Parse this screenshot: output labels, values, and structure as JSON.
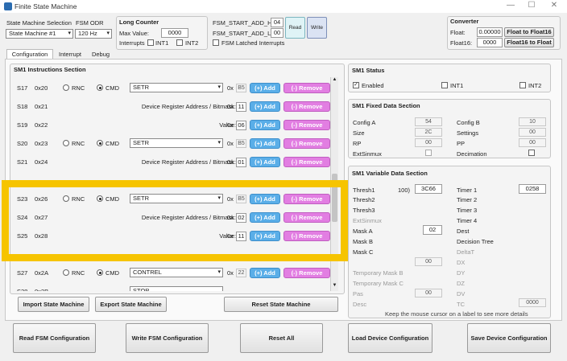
{
  "window": {
    "title": "Finite State Machine",
    "minimize": "—",
    "maximize": "☐",
    "close": "✕"
  },
  "top": {
    "sm_sel_label": "State Machine Selection",
    "sm_sel_value": "State Machine #1",
    "fsm_odr_label": "FSM ODR",
    "fsm_odr_value": "120 Hz",
    "long_counter_title": "Long Counter",
    "max_value_label": "Max Value:",
    "max_value": "0000",
    "interrupts_label": "Interrupts",
    "int1_label": "INT1",
    "int2_label": "INT2",
    "start_h_label": "FSM_START_ADD_H:",
    "start_h_value": "04",
    "start_l_label": "FSM_START_ADD_L:",
    "start_l_value": "00",
    "read_label": "Read",
    "write_label": "Write",
    "latched_label": "FSM Latched Interrupts",
    "converter_title": "Converter",
    "float_label": "Float:",
    "float_value": "0.00000",
    "to16_label": "Float to Float16",
    "float16_label": "Float16:",
    "float16_value": "0000",
    "from16_label": "Float16 to Float"
  },
  "tabs": [
    "Configuration",
    "Interrupt",
    "Debug"
  ],
  "instructions": {
    "title": "SM1 Instructions Section",
    "hex_prefix": "0x",
    "add_label": "(+) Add",
    "remove_label": "(-) Remove",
    "rnc_label": "RNC",
    "cmd_label": "CMD",
    "rows": [
      {
        "s": "S17",
        "a": "0x20",
        "type": "cmd",
        "sel": "SETR",
        "v": "B5"
      },
      {
        "s": "S18",
        "a": "0x21",
        "type": "param",
        "label": "Device Register Address / Bitmask:",
        "v": "11"
      },
      {
        "s": "S19",
        "a": "0x22",
        "type": "param",
        "label": "Value:",
        "v": "06"
      },
      {
        "s": "S20",
        "a": "0x23",
        "type": "cmd",
        "sel": "SETR",
        "v": "B5"
      },
      {
        "s": "S21",
        "a": "0x24",
        "type": "param",
        "label": "Device Register Address / Bitmask:",
        "v": "01"
      },
      {
        "s": "S23",
        "a": "0x26",
        "type": "cmd",
        "sel": "SETR",
        "v": "B5"
      },
      {
        "s": "S24",
        "a": "0x27",
        "type": "param",
        "label": "Device Register Address / Bitmask:",
        "v": "02"
      },
      {
        "s": "S25",
        "a": "0x28",
        "type": "param",
        "label": "Value:",
        "v": "11"
      },
      {
        "s": "S27",
        "a": "0x2A",
        "type": "cmd",
        "sel": "CONTREL",
        "v": "22"
      }
    ],
    "partial_row": {
      "s": "S28",
      "a": "0x2B",
      "sel": "STOP"
    }
  },
  "sm_buttons": {
    "import": "Import State Machine",
    "export": "Export State Machine",
    "reset": "Reset State Machine"
  },
  "status": {
    "title": "SM1 Status",
    "enabled": "Enabled",
    "int1": "INT1",
    "int2": "INT2"
  },
  "fixed": {
    "title": "SM1 Fixed Data Section",
    "config_a": "Config A",
    "config_a_val": "54",
    "config_b": "Config B",
    "config_b_val": "10",
    "size": "Size",
    "size_val": "2C",
    "settings": "Settings",
    "settings_val": "00",
    "rp": "RP",
    "rp_val": "00",
    "pp": "PP",
    "pp_val": "00",
    "extsinmux": "ExtSinmux",
    "decimation": "Decimation"
  },
  "variable": {
    "title": "SM1 Variable Data Section",
    "thresh1": "Thresh1",
    "thresh1_extra": "100)",
    "thresh1_val": "3C66",
    "timer1": "Timer 1",
    "timer1_val": "0258",
    "thresh2": "Thresh2",
    "timer2": "Timer 2",
    "thresh3": "Thresh3",
    "timer3": "Timer 3",
    "extsinmux": "ExtSinmux",
    "timer4": "Timer 4",
    "mask_a": "Mask A",
    "mask_a_val": "02",
    "dest": "Dest",
    "mask_b": "Mask B",
    "decision_tree": "Decision Tree",
    "mask_c": "Mask C",
    "deltat": "DeltaT",
    "dx_val": "00",
    "dx": "DX",
    "temp_mask_b": "Temporary Mask B",
    "dy": "DY",
    "temp_mask_c": "Temporary Mask C",
    "dz": "DZ",
    "pas": "Pas",
    "pas_val": "00",
    "dv": "DV",
    "desc": "Desc",
    "tc": "TC",
    "tc_val": "0000",
    "hint": "Keep the mouse cursor on a label to see more details"
  },
  "bottom": {
    "read_fsm": "Read FSM Configuration",
    "write_fsm": "Write FSM Configuration",
    "reset_all": "Reset All",
    "load_dev": "Load Device Configuration",
    "save_dev": "Save Device Configuration"
  },
  "colors": {
    "add": "#5aaee8",
    "remove": "#e27ee2",
    "highlight": "#f6c400"
  }
}
